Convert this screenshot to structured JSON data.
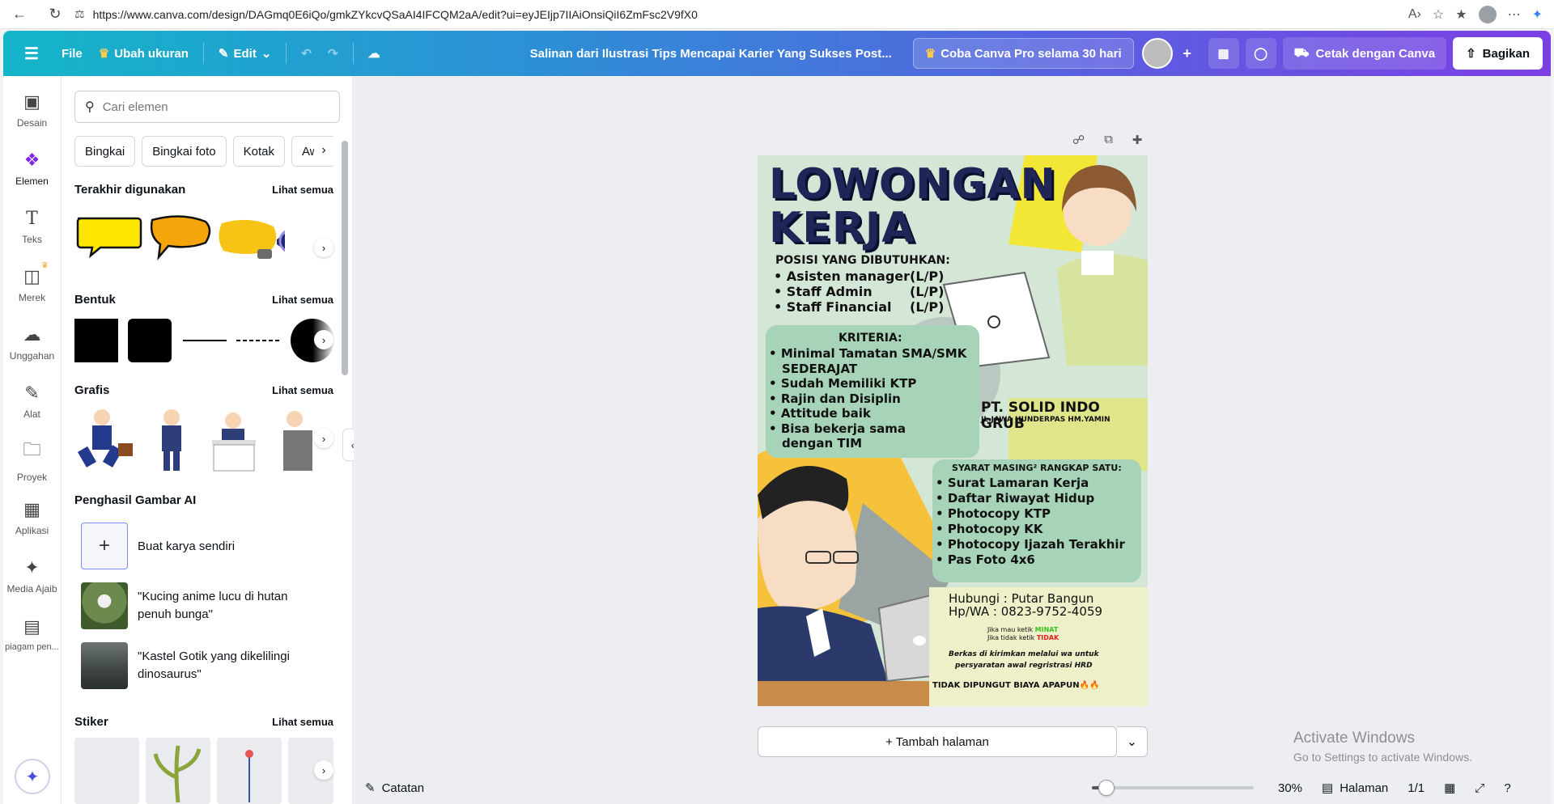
{
  "browser": {
    "url": "https://www.canva.com/design/DAGmq0E6iQo/gmkZYkcvQSaAI4IFCQM2aA/edit?ui=eyJEIjp7IIAiOnsiQiI6ZmFsc2V9fX0"
  },
  "topbar": {
    "file": "File",
    "resize": "Ubah ukuran",
    "edit": "Edit",
    "title": "Salinan dari Ilustrasi Tips Mencapai Karier Yang Sukses Post...",
    "pro": "Coba Canva Pro selama 30 hari",
    "print": "Cetak dengan Canva",
    "share": "Bagikan"
  },
  "rail": {
    "items": [
      {
        "label": "Desain",
        "icon": "design-icon"
      },
      {
        "label": "Elemen",
        "icon": "elements-icon"
      },
      {
        "label": "Teks",
        "icon": "text-icon"
      },
      {
        "label": "Merek",
        "icon": "brand-icon"
      },
      {
        "label": "Unggahan",
        "icon": "upload-icon"
      },
      {
        "label": "Alat",
        "icon": "tools-icon"
      },
      {
        "label": "Proyek",
        "icon": "folder-icon"
      },
      {
        "label": "Aplikasi",
        "icon": "apps-icon"
      },
      {
        "label": "Media Ajaib",
        "icon": "magic-media-icon"
      },
      {
        "label": "piagam pen...",
        "icon": "certificate-icon"
      }
    ]
  },
  "panel": {
    "search_placeholder": "Cari elemen",
    "chips": [
      "Bingkai",
      "Bingkai foto",
      "Kotak",
      "Awa"
    ],
    "see_all": "Lihat semua",
    "recent": "Terakhir digunakan",
    "shapes": "Bentuk",
    "graphics": "Grafis",
    "ai": "Penghasil Gambar AI",
    "ai_create": "Buat karya sendiri",
    "ai_prompt1": "\"Kucing anime lucu di hutan penuh bunga\"",
    "ai_prompt2": "\"Kastel Gotik yang dikelilingi dinosaurus\"",
    "stickers": "Stiker"
  },
  "poster": {
    "title1": "LOWONGAN",
    "title2": "KERJA",
    "positions_h": "POSISI YANG DIBUTUHKAN:",
    "positions": [
      "Asisten manager",
      "Staff Admin",
      "Staff Financial"
    ],
    "lp": "(L/P)",
    "criteria_h": "KRITERIA:",
    "criteria": [
      "Minimal Tamatan SMA/SMK",
      "SEDERAJAT",
      "Sudah Memiliki KTP",
      "Rajin dan Disiplin",
      "Attitude baik",
      "Bisa bekerja sama",
      "dengan TIM"
    ],
    "company": "PT. SOLID INDO GRUB",
    "address": "JL.JAWA HUNDERPAS HM.YAMIN",
    "req_h": "SYARAT MASING² RANGKAP SATU:",
    "reqs": [
      "Surat Lamaran Kerja",
      "Daftar Riwayat Hidup",
      "Photocopy KTP",
      "Photocopy KK",
      "Photocopy Ijazah Terakhir",
      "Pas Foto 4x6"
    ],
    "contact1": "Hubungi : Putar Bangun",
    "contact2": "Hp/WA   : 0823-9752-4059",
    "note1a": "Jika mau ketik ",
    "note1b": "MINAT",
    "note2a": "Jika tidak ketik ",
    "note2b": "TIDAK",
    "note3": "Berkas di kirimkan melalui wa untuk",
    "note4": "persyaratan awal regristrasi HRD",
    "free": "TIDAK DIPUNGUT BIAYA APAPUN🔥🔥"
  },
  "canvas": {
    "add_page": "+ Tambah halaman",
    "activate1": "Activate Windows",
    "activate2": "Go to Settings to activate Windows.",
    "notes": "Catatan",
    "zoom_pct": 30,
    "zoom": "30%",
    "pages_label": "Halaman",
    "pages": "1/1"
  },
  "colors": {
    "accent": "#7d2ae8",
    "poster_title": "#1f2556",
    "box": "#a7d4b8"
  }
}
